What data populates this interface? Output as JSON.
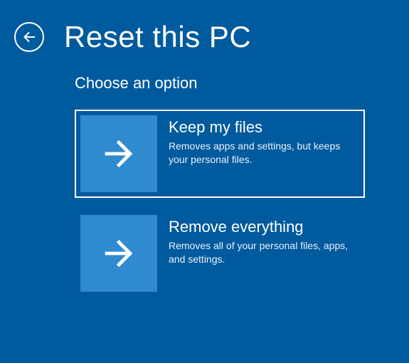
{
  "header": {
    "title": "Reset this PC"
  },
  "subtitle": "Choose an option",
  "options": [
    {
      "title": "Keep my files",
      "description": "Removes apps and settings, but keeps your personal files.",
      "selected": true
    },
    {
      "title": "Remove everything",
      "description": "Removes all of your personal files, apps, and settings.",
      "selected": false
    }
  ],
  "colors": {
    "background": "#005A9E",
    "tile": "#2F8AD0",
    "text": "#ffffff"
  }
}
